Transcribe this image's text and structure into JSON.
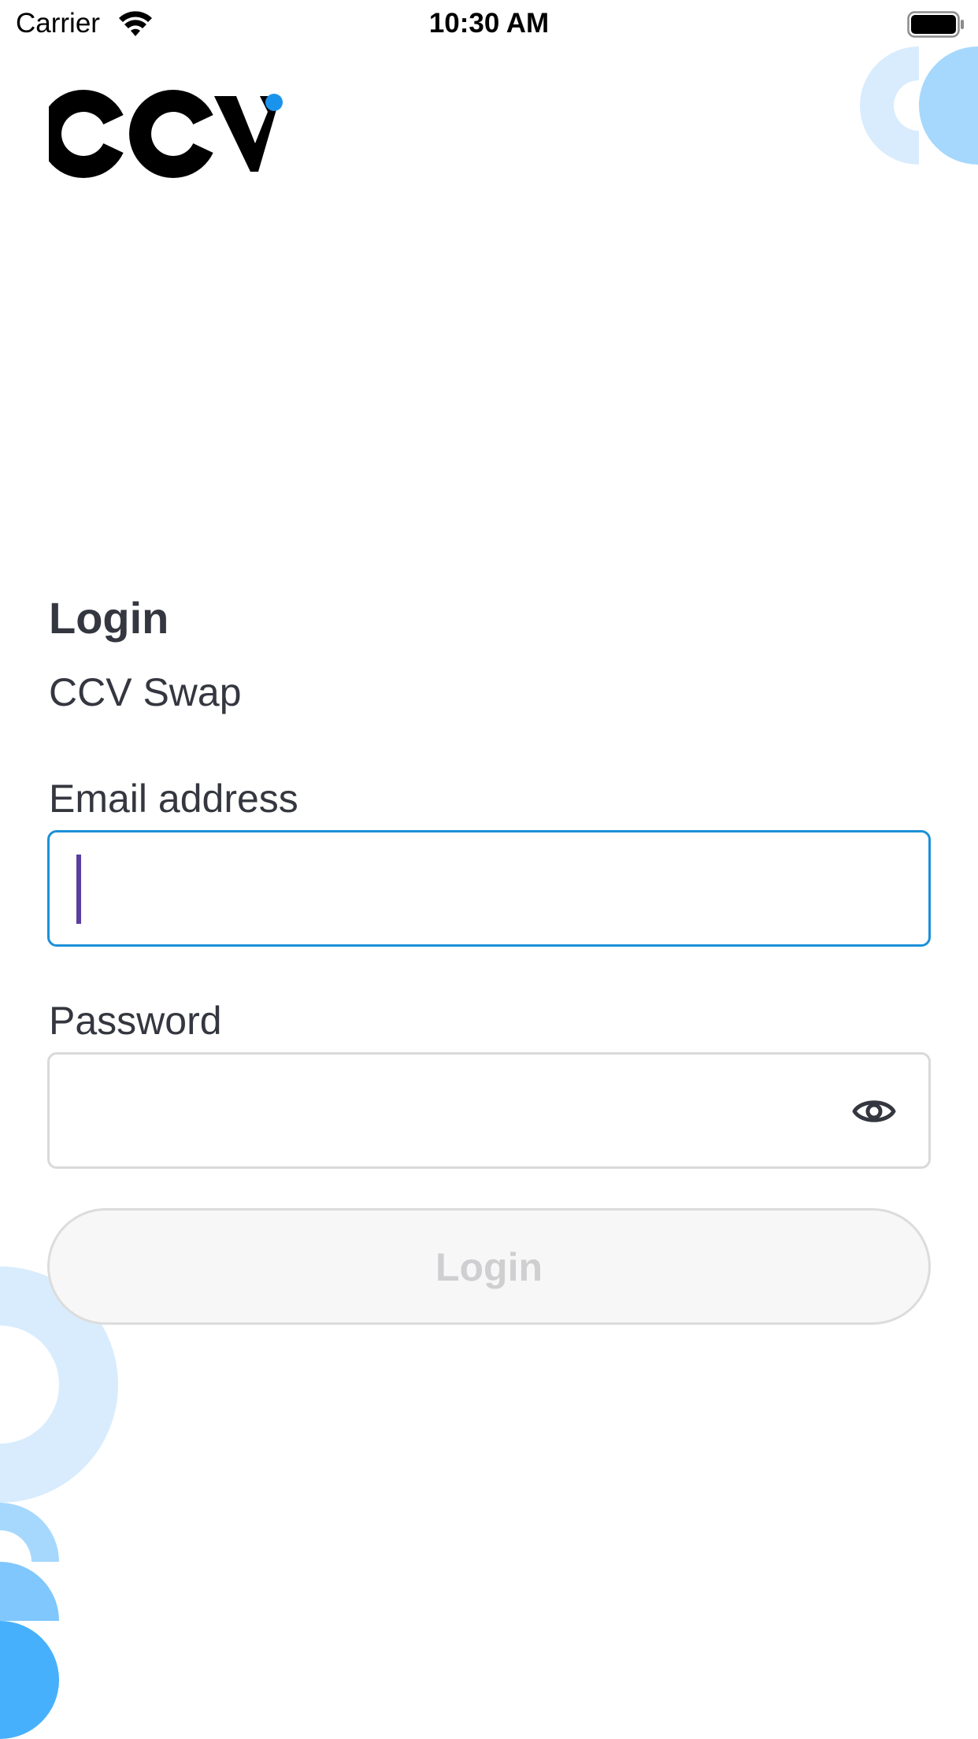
{
  "status_bar": {
    "carrier": "Carrier",
    "time": "10:30 AM"
  },
  "logo": {
    "text": "CCV",
    "dot_color": "#1a93ec"
  },
  "login": {
    "title": "Login",
    "subtitle": "CCV Swap",
    "email_label": "Email address",
    "email_value": "",
    "password_label": "Password",
    "password_value": "",
    "button_label": "Login"
  },
  "colors": {
    "focus_border": "#1c90d8",
    "text": "#34373f",
    "decor_light": "#d8ecfd",
    "decor_mid": "#a6d8fd",
    "decor_dark": "#47b0fd"
  },
  "icons": {
    "status": [
      "wifi-icon",
      "battery-icon"
    ],
    "password_toggle": "eye-icon"
  }
}
